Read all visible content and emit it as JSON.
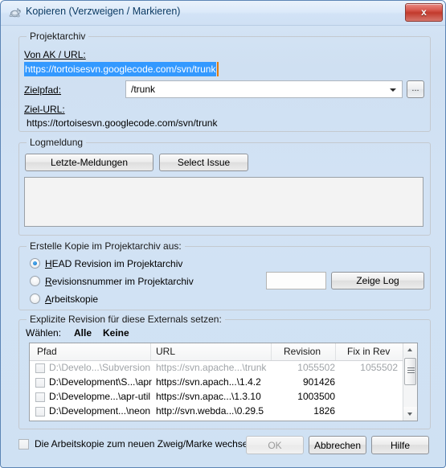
{
  "window": {
    "title": "Kopieren (Verzweigen / Markieren)",
    "icon": "tortoise-icon",
    "close_label": "x",
    "bg_color": "#d2e2f3",
    "title_color": "#0b3a63",
    "close_color": "#c23a2d"
  },
  "repository": {
    "legend": "Projektarchiv",
    "from_url_label": "Von AK / URL:",
    "from_url_value": "https://tortoisesvn.googlecode.com/svn/trunk",
    "from_url_selected": true,
    "selection_color": "#3399ff",
    "caret_color": "#e07b10",
    "target_path_label": "Zielpfad:",
    "target_path_value": "/trunk",
    "browse_label": "...",
    "target_url_label": "Ziel-URL:",
    "target_url_value": "https://tortoisesvn.googlecode.com/svn/trunk"
  },
  "logmessage": {
    "legend": "Logmeldung",
    "recent_button": "Letzte-Meldungen",
    "select_issue_button": "Select Issue",
    "text_value": ""
  },
  "copy_source": {
    "legend": "Erstelle Kopie im Projektarchiv aus:",
    "options": [
      {
        "label": "HEAD Revision im Projektarchiv",
        "checked": true
      },
      {
        "label": "Revisionsnummer im Projektarchiv",
        "checked": false
      },
      {
        "label": "Arbeitskopie",
        "checked": false
      }
    ],
    "revision_value": "",
    "show_log_button": "Zeige Log"
  },
  "externals": {
    "legend": "Explizite Revision für diese Externals setzen:",
    "choose_label": "Wählen:",
    "select_all_label": "Alle",
    "select_none_label": "Keine",
    "columns": [
      "Pfad",
      "URL",
      "Revision",
      "Fix in Rev"
    ],
    "rows": [
      {
        "checked": false,
        "dimmed": true,
        "path": "D:\\Develo...\\Subversion",
        "url": "https://svn.apache...\\trunk",
        "revision": "1055502",
        "fix_in_rev": "1055502"
      },
      {
        "checked": false,
        "dimmed": false,
        "path": "D:\\Development\\S...\\apr",
        "url": "https://svn.apach...\\1.4.2",
        "revision": "901426",
        "fix_in_rev": ""
      },
      {
        "checked": false,
        "dimmed": false,
        "path": "D:\\Developme...\\apr-util",
        "url": "https://svn.apac...\\1.3.10",
        "revision": "1003500",
        "fix_in_rev": ""
      },
      {
        "checked": false,
        "dimmed": false,
        "path": "D:\\Development...\\neon",
        "url": "http://svn.webda...\\0.29.5",
        "revision": "1826",
        "fix_in_rev": ""
      }
    ]
  },
  "footer": {
    "switch_checkbox_label": "Die Arbeitskopie zum neuen Zweig/Marke wechseln",
    "switch_checked": false,
    "ok_label": "OK",
    "ok_enabled": false,
    "cancel_label": "Abbrechen",
    "help_label": "Hilfe"
  }
}
